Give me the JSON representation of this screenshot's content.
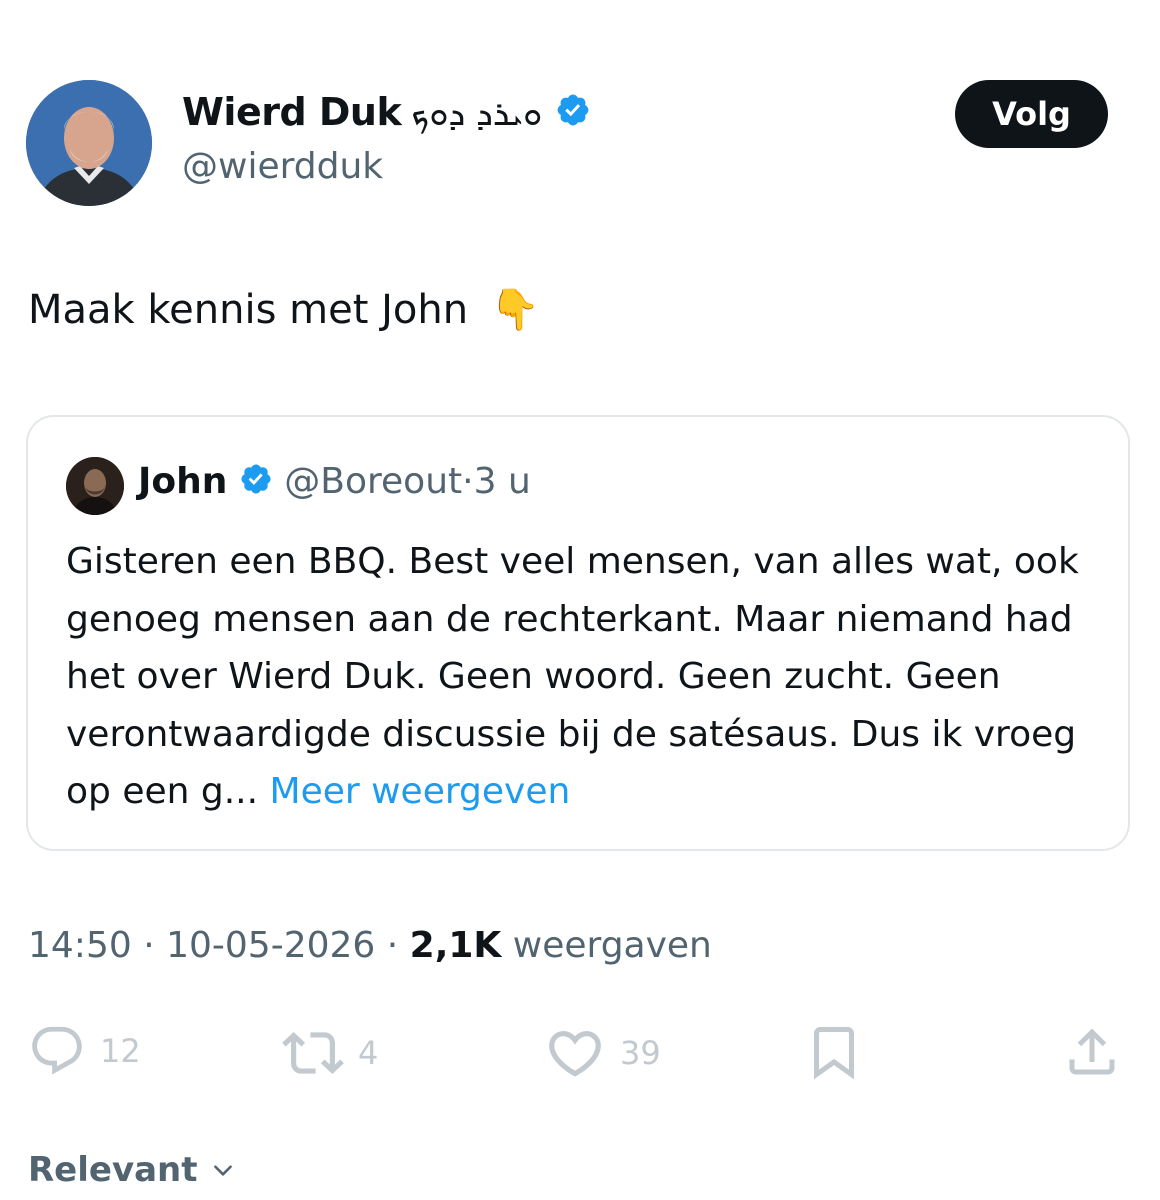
{
  "author": {
    "name": "Wierd Duk",
    "name_script": "ܘܝܪܕ ܕܘܟ",
    "handle": "@wierdduk"
  },
  "follow_label": "Volg",
  "tweet_text": "Maak kennis met John",
  "tweet_emoji": "👇",
  "quote": {
    "name": "John",
    "handle": "@Boreout",
    "separator": "·",
    "time": "3 u",
    "body": "Gisteren een BBQ. Best veel mensen, van alles wat, ook genoeg mensen aan de rechterkant. Maar niemand had het over Wierd Duk. Geen woord. Geen zucht. Geen verontwaardigde discussie bij de satésaus. Dus ik vroeg op een g... ",
    "more_label": "Meer weergeven"
  },
  "meta": {
    "time": "14:50",
    "date": "10-05-2026",
    "views_count": "2,1K",
    "views_label": "weergaven"
  },
  "actions": {
    "replies": "12",
    "reposts": "4",
    "likes": "39"
  },
  "sort_label": "Relevant",
  "colors": {
    "primary_text": "#0f1419",
    "secondary_text": "#536471",
    "link": "#1d9bf0",
    "verified": "#1d9bf0",
    "action_icons": "#c2c9cf"
  }
}
